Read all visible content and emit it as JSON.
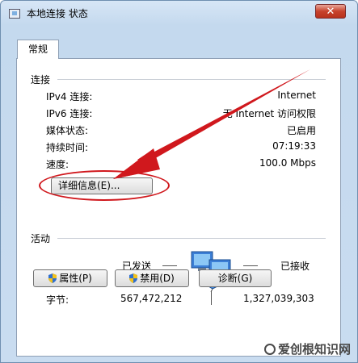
{
  "window": {
    "title": "本地连接 状态",
    "close_symbol": "✕"
  },
  "tab": {
    "label": "常规"
  },
  "connection": {
    "section_label": "连接",
    "rows": [
      {
        "label": "IPv4 连接:",
        "value": "Internet"
      },
      {
        "label": "IPv6 连接:",
        "value": "无 Internet 访问权限"
      },
      {
        "label": "媒体状态:",
        "value": "已启用"
      },
      {
        "label": "持续时间:",
        "value": "07:19:33"
      },
      {
        "label": "速度:",
        "value": "100.0 Mbps"
      }
    ],
    "details_button": "详细信息(E)..."
  },
  "activity": {
    "section_label": "活动",
    "sent_label": "已发送",
    "received_label": "已接收",
    "bytes_label": "字节:",
    "bytes_sent": "567,472,212",
    "bytes_received": "1,327,039,303"
  },
  "buttons": {
    "properties": "属性(P)",
    "disable": "禁用(D)",
    "diagnose": "诊断(G)"
  },
  "watermark": {
    "text": "爱创根知识网"
  },
  "colors": {
    "annotation_red": "#d0181d",
    "shield_blue": "#2f6fd0",
    "shield_yellow": "#f2c21b"
  }
}
